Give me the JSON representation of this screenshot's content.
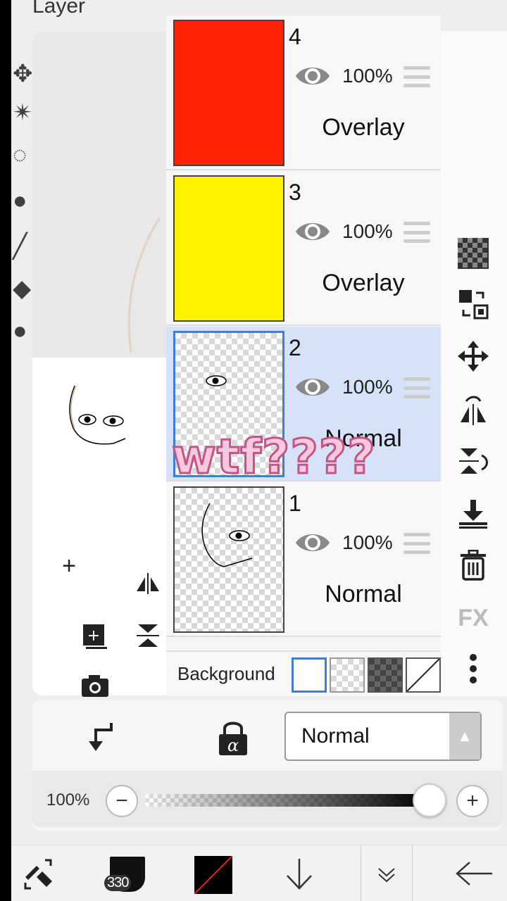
{
  "header": {
    "title": "Layer"
  },
  "layers": [
    {
      "number": "4",
      "opacity": "100%",
      "blend": "Overlay",
      "fill": "#ff2200"
    },
    {
      "number": "3",
      "opacity": "100%",
      "blend": "Overlay",
      "fill": "#fff200"
    },
    {
      "number": "2",
      "opacity": "100%",
      "blend": "Normal",
      "selected": true
    },
    {
      "number": "1",
      "opacity": "100%",
      "blend": "Normal"
    }
  ],
  "background": {
    "label": "Background"
  },
  "blend_mode": {
    "value": "Normal"
  },
  "opacity_row": {
    "label": "100%",
    "value_percent": 100
  },
  "overlay_text": "wtf????",
  "toolbar": {
    "brush_size": "330",
    "color": "#000000"
  },
  "icons": {
    "right": [
      "checker-icon",
      "transfer-icon",
      "move-icon",
      "flip-icon",
      "rotate-icon",
      "merge-down-icon",
      "trash-icon",
      "fx-icon",
      "more-icon"
    ],
    "fx_label": "FX"
  }
}
